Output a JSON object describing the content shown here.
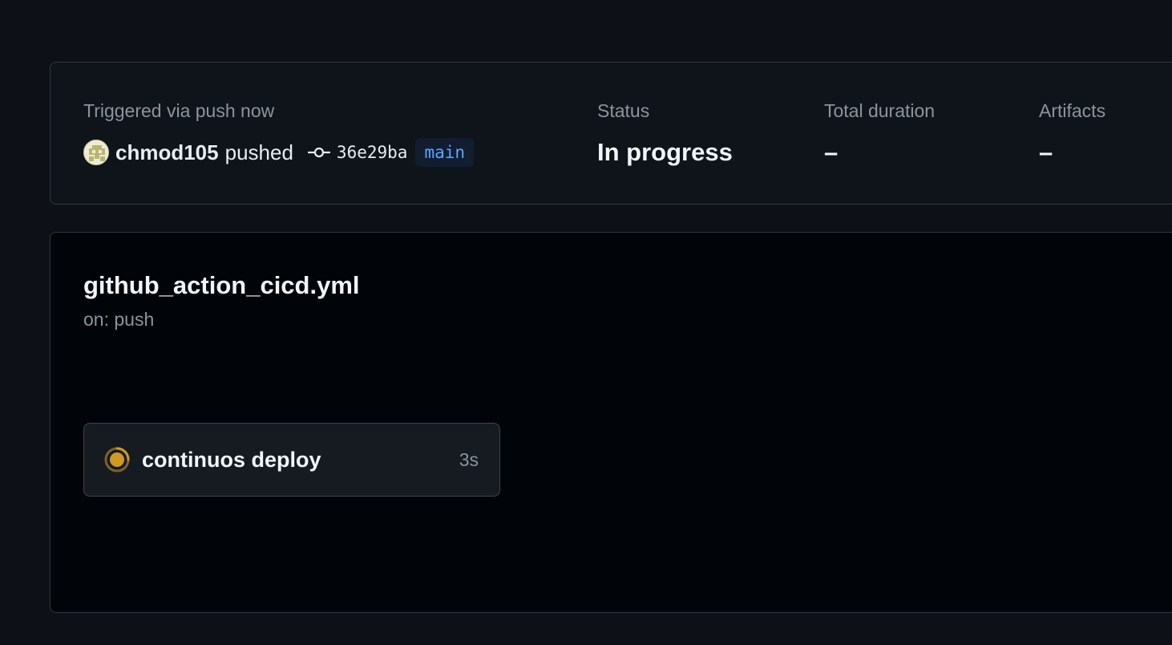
{
  "summary": {
    "trigger_label": "Triggered via push now",
    "actor": "chmod105",
    "action": "pushed",
    "commit_sha": "36e29ba",
    "branch": "main",
    "status_label": "Status",
    "status_value": "In progress",
    "duration_label": "Total duration",
    "duration_value": "–",
    "artifacts_label": "Artifacts",
    "artifacts_value": "–"
  },
  "workflow": {
    "file_name": "github_action_cicd.yml",
    "trigger": "on: push",
    "jobs": [
      {
        "name": "continuos deploy",
        "duration": "3s",
        "status": "in-progress",
        "status_color": "#d29922"
      }
    ]
  },
  "colors": {
    "background": "#0d1117",
    "panel": "#010409",
    "muted_text": "#8b949e",
    "branch_text": "#58a6ff",
    "in_progress": "#d29922"
  },
  "icons": {
    "avatar": "user-avatar-icon",
    "commit": "git-commit-icon",
    "job_status": "in-progress-status-icon"
  }
}
